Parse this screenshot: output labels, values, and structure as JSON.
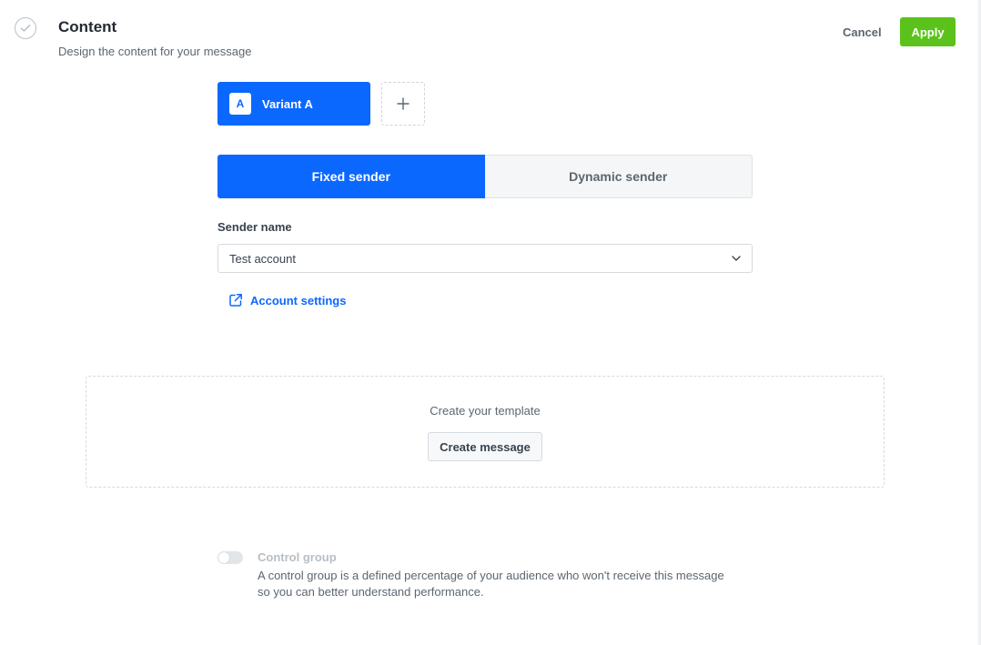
{
  "header": {
    "title": "Content",
    "subtitle": "Design the content for your message",
    "cancel_label": "Cancel",
    "apply_label": "Apply",
    "step_icon": "check-circle-icon"
  },
  "variants": {
    "items": [
      {
        "badge": "A",
        "label": "Variant A",
        "active": true
      }
    ],
    "add_icon": "plus-icon"
  },
  "sender": {
    "options": [
      {
        "label": "Fixed sender",
        "active": true
      },
      {
        "label": "Dynamic sender",
        "active": false
      }
    ],
    "field_label": "Sender name",
    "selected_value": "Test account",
    "dropdown_icon": "chevron-down-icon",
    "link_label": "Account settings",
    "link_icon": "external-link-icon"
  },
  "template": {
    "prompt": "Create your template",
    "button_label": "Create message"
  },
  "control_group": {
    "enabled": false,
    "title": "Control group",
    "description": "A control group is a defined percentage of your audience who won't receive this message so you can better understand performance."
  },
  "colors": {
    "primary": "#0b68ff",
    "apply": "#5bc21b",
    "text": "#384350",
    "muted": "#5c6670",
    "disabled": "#b8bec4"
  }
}
